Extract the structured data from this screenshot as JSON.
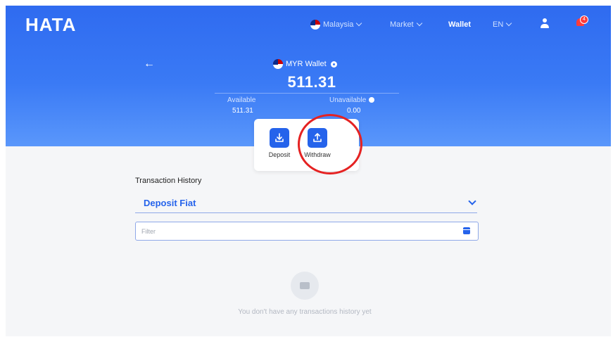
{
  "brand": {
    "logo": "HATA"
  },
  "nav": {
    "country": "Malaysia",
    "market": "Market",
    "wallet": "Wallet",
    "language": "EN",
    "notification_badge": "4"
  },
  "wallet": {
    "title": "MYR Wallet",
    "balance": "511.31",
    "available_label": "Available",
    "available_value": "511.31",
    "unavailable_label": "Unavailable",
    "unavailable_value": "0.00"
  },
  "actions": {
    "deposit_label": "Deposit",
    "withdraw_label": "Withdraw"
  },
  "history": {
    "title": "Transaction History",
    "selected_type": "Deposit Fiat",
    "filter_placeholder": "Filter",
    "empty_message": "You don't have any transactions history yet"
  },
  "colors": {
    "primary": "#2563eb",
    "header_gradient_top": "#2f6bf0",
    "header_gradient_bottom": "#5a97fb",
    "highlight_ring": "#e52222"
  },
  "icons": {
    "back": "arrow-left-icon",
    "deposit": "download-icon",
    "withdraw": "upload-icon",
    "calendar": "calendar-icon",
    "empty": "wallet-icon"
  }
}
